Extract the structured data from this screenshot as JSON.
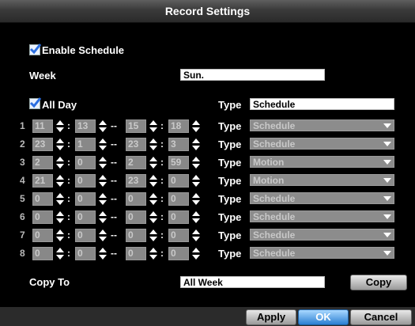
{
  "title": "Record Settings",
  "enable_schedule": {
    "label": "Enable Schedule",
    "checked": true
  },
  "week": {
    "label": "Week",
    "value": "Sun."
  },
  "all_day": {
    "label": "All Day",
    "checked": true
  },
  "type_label": "Type",
  "main_type": "Schedule",
  "sep_colon": ":",
  "sep_dash": "--",
  "rows": [
    {
      "n": "1",
      "sh": "11",
      "sm": "13",
      "eh": "15",
      "em": "18",
      "type": "Schedule"
    },
    {
      "n": "2",
      "sh": "23",
      "sm": "1",
      "eh": "23",
      "em": "3",
      "type": "Schedule"
    },
    {
      "n": "3",
      "sh": "2",
      "sm": "0",
      "eh": "2",
      "em": "59",
      "type": "Motion"
    },
    {
      "n": "4",
      "sh": "21",
      "sm": "0",
      "eh": "23",
      "em": "0",
      "type": "Motion"
    },
    {
      "n": "5",
      "sh": "0",
      "sm": "0",
      "eh": "0",
      "em": "0",
      "type": "Schedule"
    },
    {
      "n": "6",
      "sh": "0",
      "sm": "0",
      "eh": "0",
      "em": "0",
      "type": "Schedule"
    },
    {
      "n": "7",
      "sh": "0",
      "sm": "0",
      "eh": "0",
      "em": "0",
      "type": "Schedule"
    },
    {
      "n": "8",
      "sh": "0",
      "sm": "0",
      "eh": "0",
      "em": "0",
      "type": "Schedule"
    }
  ],
  "copy_to": {
    "label": "Copy To",
    "value": "All Week"
  },
  "buttons": {
    "copy": "Copy",
    "apply": "Apply",
    "ok": "OK",
    "cancel": "Cancel"
  },
  "colors": {
    "background": "#000000",
    "disabled_field": "#8c8c8c",
    "active_button": "#2a7fd2"
  }
}
